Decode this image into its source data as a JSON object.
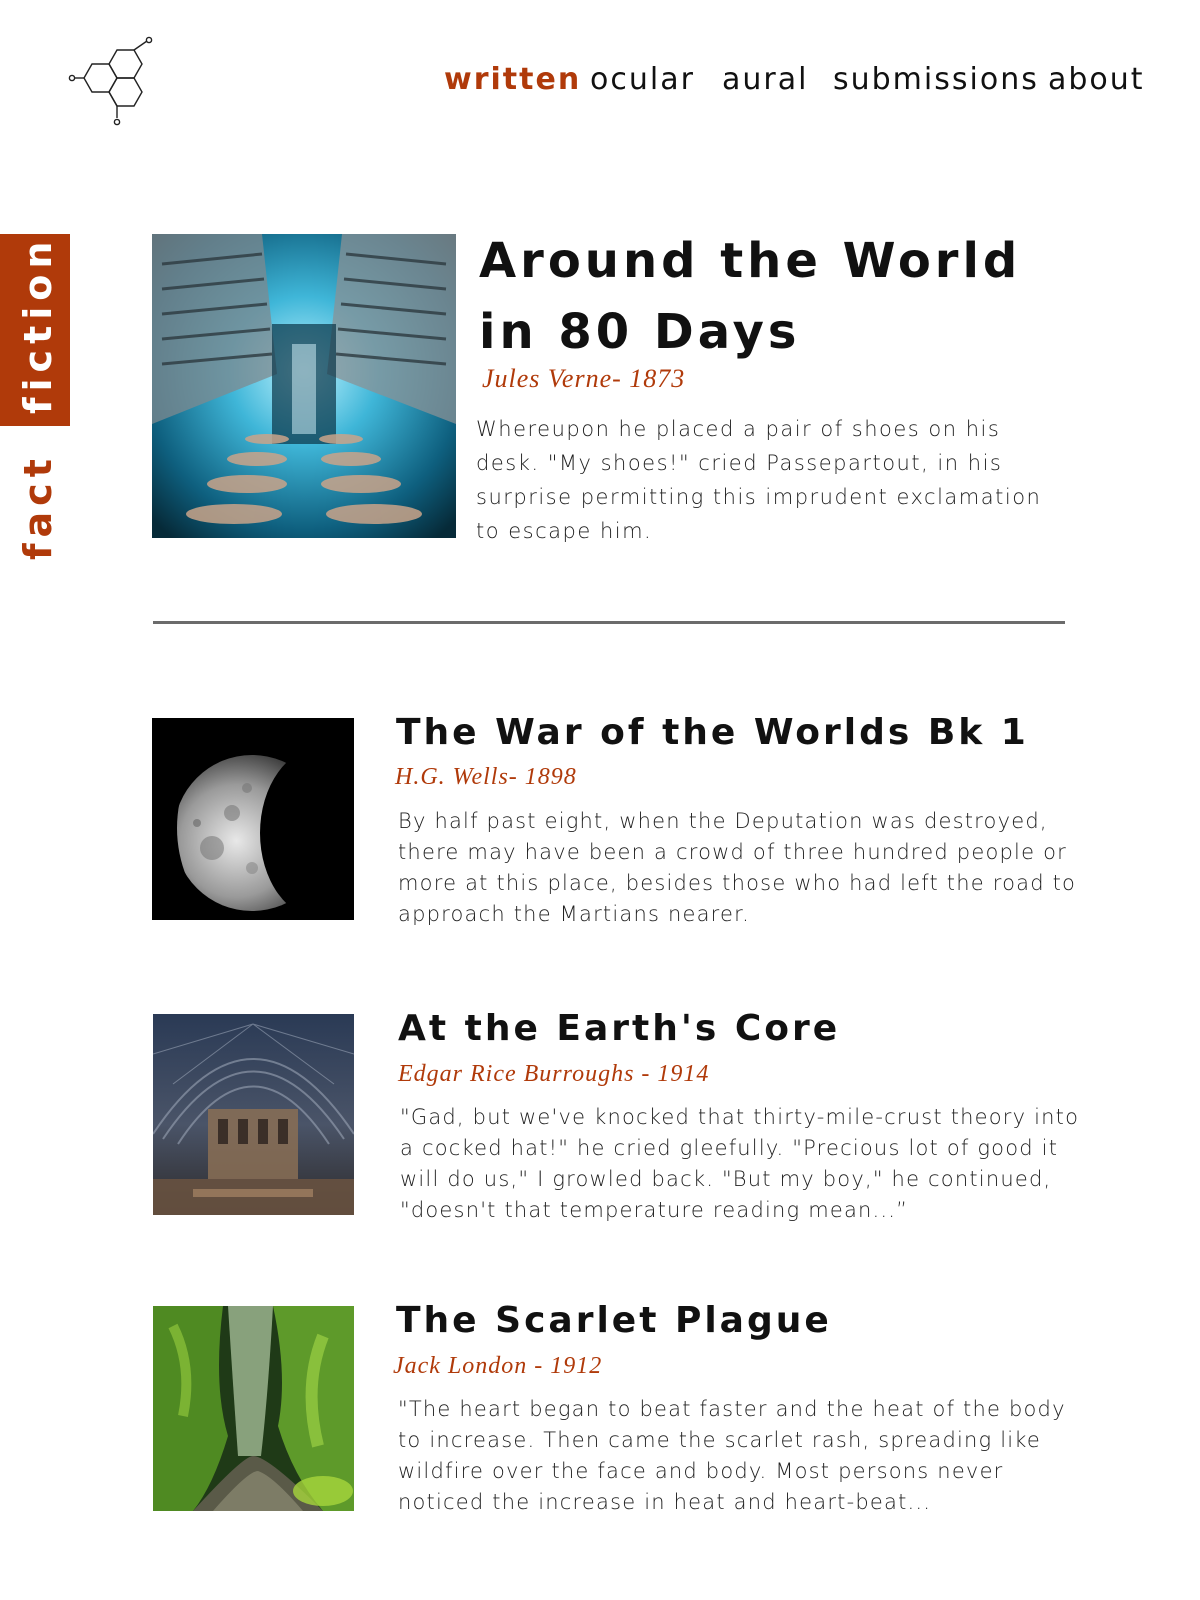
{
  "nav": {
    "items": [
      {
        "label": "written",
        "active": true
      },
      {
        "label": "ocular",
        "active": false
      },
      {
        "label": "aural",
        "active": false
      },
      {
        "label": "submissions",
        "active": false
      },
      {
        "label": "about",
        "active": false
      }
    ]
  },
  "side_tab": {
    "word_fact": "fact",
    "word_fiction": "fiction"
  },
  "colors": {
    "accent": "#b03a0a",
    "text": "#111111",
    "divider": "#6b6b6b",
    "background": "#ffffff"
  },
  "featured": {
    "title": "Around the World in 80 Days",
    "byline": "Jules Verne- 1873",
    "excerpt": "Whereupon he placed a pair of shoes on his desk. \"My shoes!\" cried Passepartout, in his surprise permitting this imprudent exclamation to escape him.",
    "image": "blue-industrial-tunnel"
  },
  "articles": [
    {
      "title": "The War of the Worlds Bk 1",
      "byline": "H.G. Wells- 1898",
      "excerpt": "By half past eight, when the Deputation was destroyed, there may have been a crowd of three hundred people or more at this place, besides those who had left the road to approach the Martians nearer.",
      "image": "half-moon"
    },
    {
      "title": "At the Earth's Core",
      "byline": "Edgar Rice Burroughs - 1914",
      "excerpt": "\"Gad, but we've knocked that thirty-mile-crust theory into a cocked hat!\" he cried gleefully. \"Precious lot of good it will do us,\" I growled back. \"But my boy,\" he continued, \"doesn't that temperature reading mean...”",
      "image": "vaulted-hall-interior"
    },
    {
      "title": "The Scarlet Plague",
      "byline": "Jack London - 1912",
      "excerpt": "\"The heart began to beat faster and the heat of the body to increase.  Then came the scarlet rash, spreading like wildfire over the face and  body. Most persons never noticed the increase in heat and heart-beat...",
      "image": "mossy-canyon"
    }
  ]
}
